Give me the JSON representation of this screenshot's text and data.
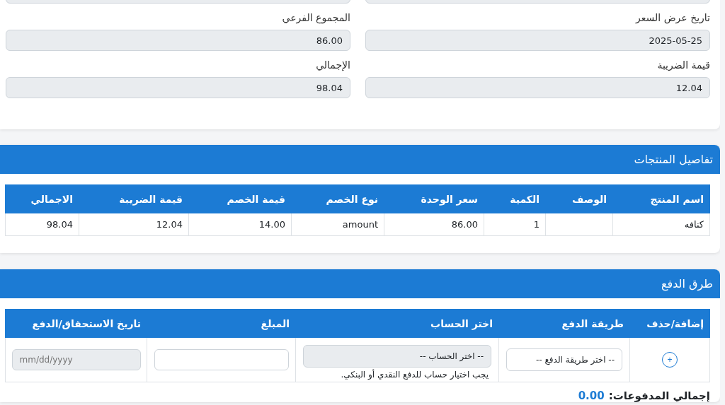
{
  "summary": {
    "fields": [
      {
        "label": "تاريخ عرض السعر",
        "value": "2025-05-25"
      },
      {
        "label": "المجموع الفرعي",
        "value": "86.00"
      },
      {
        "label": "قيمة الضريبة",
        "value": "12.04"
      },
      {
        "label": "الإجمالي",
        "value": "98.04"
      }
    ]
  },
  "products": {
    "title": "تفاصيل المنتجات",
    "columns": [
      "اسم المنتج",
      "الوصف",
      "الكمية",
      "سعر الوحدة",
      "نوع الخصم",
      "قيمة الخصم",
      "قيمة الضريبة",
      "الاجمالي"
    ],
    "rows": [
      [
        "كنافه",
        "",
        "1",
        "86.00",
        "amount",
        "14.00",
        "12.04",
        "98.04"
      ]
    ]
  },
  "payments": {
    "title": "طرق الدفع",
    "columns": [
      "إضافة/حذف",
      "طريقة الدفع",
      "اختر الحساب",
      "المبلغ",
      "تاريخ الاستحقاق/الدفع"
    ],
    "row": {
      "add_button": "+",
      "method": {
        "value": "-- اختر طريقة الدفع --",
        "disabled": false
      },
      "account": {
        "value": "-- اختر الحساب --",
        "disabled": true
      },
      "account_hint": "يجب اختيار حساب للدفع النقدي أو البنكي.",
      "amount": {
        "disabled": false
      },
      "date": {
        "placeholder": "mm/dd/yyyy",
        "disabled": true
      }
    },
    "total_label": "إجمالي المدفوعات:",
    "total_value": "0.00"
  }
}
